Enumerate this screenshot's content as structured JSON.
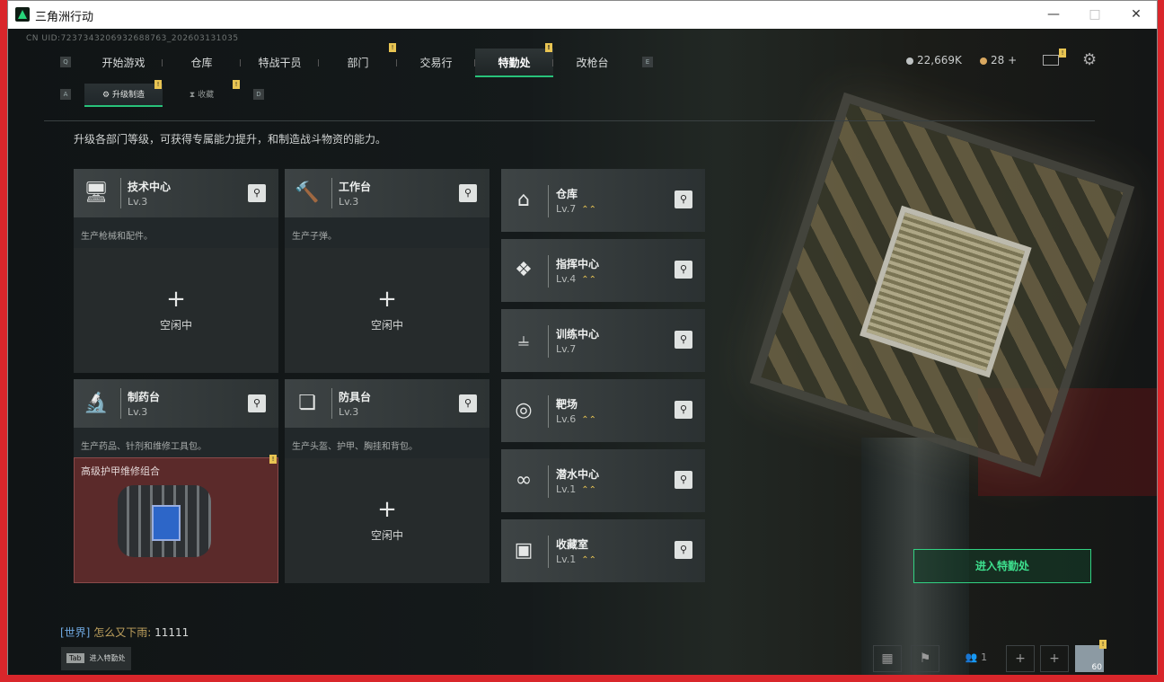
{
  "window": {
    "title": "三角洲行动"
  },
  "uid": "CN UID:7237343206932688763_202603131035",
  "nav": {
    "tabs": [
      {
        "label": "开始游戏",
        "active": false,
        "badge": false
      },
      {
        "label": "仓库",
        "active": false,
        "badge": false
      },
      {
        "label": "特战干员",
        "active": false,
        "badge": false
      },
      {
        "label": "部门",
        "active": false,
        "badge": true
      },
      {
        "label": "交易行",
        "active": false,
        "badge": false
      },
      {
        "label": "特勤处",
        "active": true,
        "badge": true
      },
      {
        "label": "改枪台",
        "active": false,
        "badge": false
      }
    ],
    "key_left": "Q",
    "key_right": "E"
  },
  "currency": {
    "coins": "22,669K",
    "tickets": "28 +"
  },
  "subnav": {
    "tabs": [
      {
        "label": "升级制造",
        "active": true
      },
      {
        "label": "收藏",
        "active": false
      }
    ],
    "key_left": "A",
    "key_right": "D"
  },
  "badge_mark": "!",
  "description": "升级各部门等级，可获得专属能力提升，和制造战斗物资的能力。",
  "stations": [
    {
      "name": "技术中心",
      "level": "Lv.3",
      "desc": "生产枪械和配件。",
      "status": "空闲中",
      "icon": "computer-icon"
    },
    {
      "name": "工作台",
      "level": "Lv.3",
      "desc": "生产子弹。",
      "status": "空闲中",
      "icon": "hammer-wrench-icon"
    },
    {
      "name": "制药台",
      "level": "Lv.3",
      "desc": "生产药品、针剂和维修工具包。",
      "item": "高级护甲维修组合",
      "icon": "microscope-icon"
    },
    {
      "name": "防具台",
      "level": "Lv.3",
      "desc": "生产头盔、护甲、胸挂和背包。",
      "status": "空闲中",
      "icon": "cubes-icon"
    }
  ],
  "facilities": [
    {
      "name": "仓库",
      "level": "Lv.7",
      "upgradable": true,
      "icon": "warehouse-icon"
    },
    {
      "name": "指挥中心",
      "level": "Lv.4",
      "upgradable": true,
      "icon": "command-icon"
    },
    {
      "name": "训练中心",
      "level": "Lv.7",
      "upgradable": false,
      "icon": "dumbbell-icon"
    },
    {
      "name": "靶场",
      "level": "Lv.6",
      "upgradable": true,
      "icon": "target-icon"
    },
    {
      "name": "潜水中心",
      "level": "Lv.1",
      "upgradable": true,
      "icon": "goggles-icon"
    },
    {
      "name": "收藏室",
      "level": "Lv.1",
      "upgradable": true,
      "icon": "collection-icon"
    }
  ],
  "enter_button": "进入特勤处",
  "chat": {
    "channel": "[世界]",
    "user": "怎么又下雨:",
    "message": "11111"
  },
  "tab_hint": {
    "key": "Tab",
    "label": "进入特勤处"
  },
  "bottom": {
    "friends": "1",
    "level": "60"
  },
  "colors": {
    "accent_green": "#28c27a",
    "badge_yellow": "#e8c452",
    "title_bar_red": "#d9262b"
  }
}
